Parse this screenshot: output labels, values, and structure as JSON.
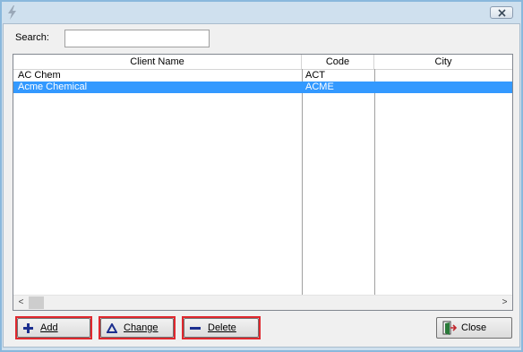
{
  "window": {
    "close_glyph": "×"
  },
  "search": {
    "label": "Search:",
    "value": "",
    "placeholder": ""
  },
  "grid": {
    "columns": [
      {
        "label": "Client Name"
      },
      {
        "label": "Code"
      },
      {
        "label": "City"
      }
    ],
    "rows": [
      {
        "name": "AC Chem",
        "code": "ACT",
        "city": "",
        "selected": false
      },
      {
        "name": "Acme Chemical",
        "code": "ACME",
        "city": "",
        "selected": true
      }
    ],
    "selection_color": "#3399ff"
  },
  "scrollbar": {
    "left_arrow": "<",
    "right_arrow": ">"
  },
  "buttons": {
    "add": "Add",
    "change": "Change",
    "delete": "Delete",
    "close": "Close"
  },
  "colors": {
    "highlight": "#e0282e",
    "icon_blue": "#1c2f8f"
  }
}
